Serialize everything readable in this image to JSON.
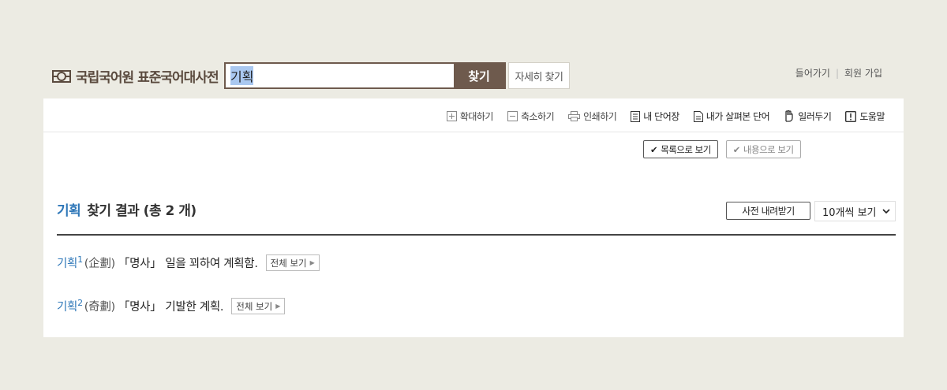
{
  "header": {
    "logo_text": "국립국어원 표준국어대사전",
    "search": {
      "value": "기획",
      "button_label": "찾기"
    },
    "advanced_search_label": "자세히 찾기",
    "login_label": "들어가기",
    "join_label": "회원 가입"
  },
  "toolbar": {
    "zoom_in": "확대하기",
    "zoom_out": "축소하기",
    "print": "인쇄하기",
    "my_words": "내 단어장",
    "viewed_words": "내가 살펴본 단어",
    "notify": "일러두기",
    "help": "도움말"
  },
  "view": {
    "list_label": "목록으로 보기",
    "content_label": "내용으로 보기"
  },
  "results": {
    "keyword": "기획",
    "summary": "찾기 결과 (총 2 개)",
    "download_label": "사전 내려받기",
    "per_page": "10개씩 보기",
    "entries": [
      {
        "word": "기획",
        "num": "1",
        "hanja": "(企劃)",
        "pos": "「명사」",
        "def": "일을 꾀하여 계획함.",
        "more": "전체 보기"
      },
      {
        "word": "기획",
        "num": "2",
        "hanja": "(奇劃)",
        "pos": "「명사」",
        "def": "기발한 계획.",
        "more": "전체 보기"
      }
    ]
  },
  "colors": {
    "brand": "#6e5a4d",
    "link": "#2e77b8",
    "background": "#ecebe3"
  }
}
